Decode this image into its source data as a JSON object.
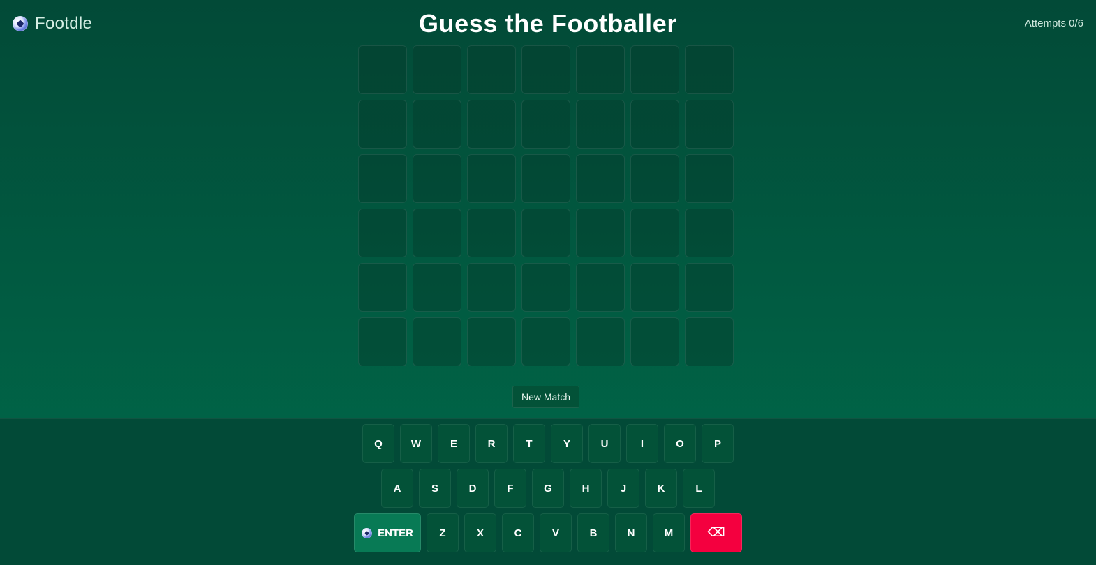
{
  "brand": {
    "name": "Footdle",
    "icon": "soccer-ball-icon"
  },
  "title": "Guess the Footballer",
  "attempts": {
    "label": "Attempts 0/6",
    "used": 0,
    "max": 6
  },
  "board": {
    "rows": 6,
    "cols": 7,
    "guesses": []
  },
  "new_match_label": "New Match",
  "keyboard": {
    "row1": [
      "Q",
      "W",
      "E",
      "R",
      "T",
      "Y",
      "U",
      "I",
      "O",
      "P"
    ],
    "row2": [
      "A",
      "S",
      "D",
      "F",
      "G",
      "H",
      "J",
      "K",
      "L"
    ],
    "row3": [
      "Z",
      "X",
      "C",
      "V",
      "B",
      "N",
      "M"
    ],
    "enter_label": "ENTER",
    "enter_icon": "soccer-ball-icon",
    "backspace_glyph": "⌫",
    "backspace_icon": "backspace-icon"
  },
  "colors": {
    "background_top": "#024a37",
    "background_bottom": "#006b4b",
    "enter_key": "#087a55",
    "backspace_key": "#f4003f"
  }
}
